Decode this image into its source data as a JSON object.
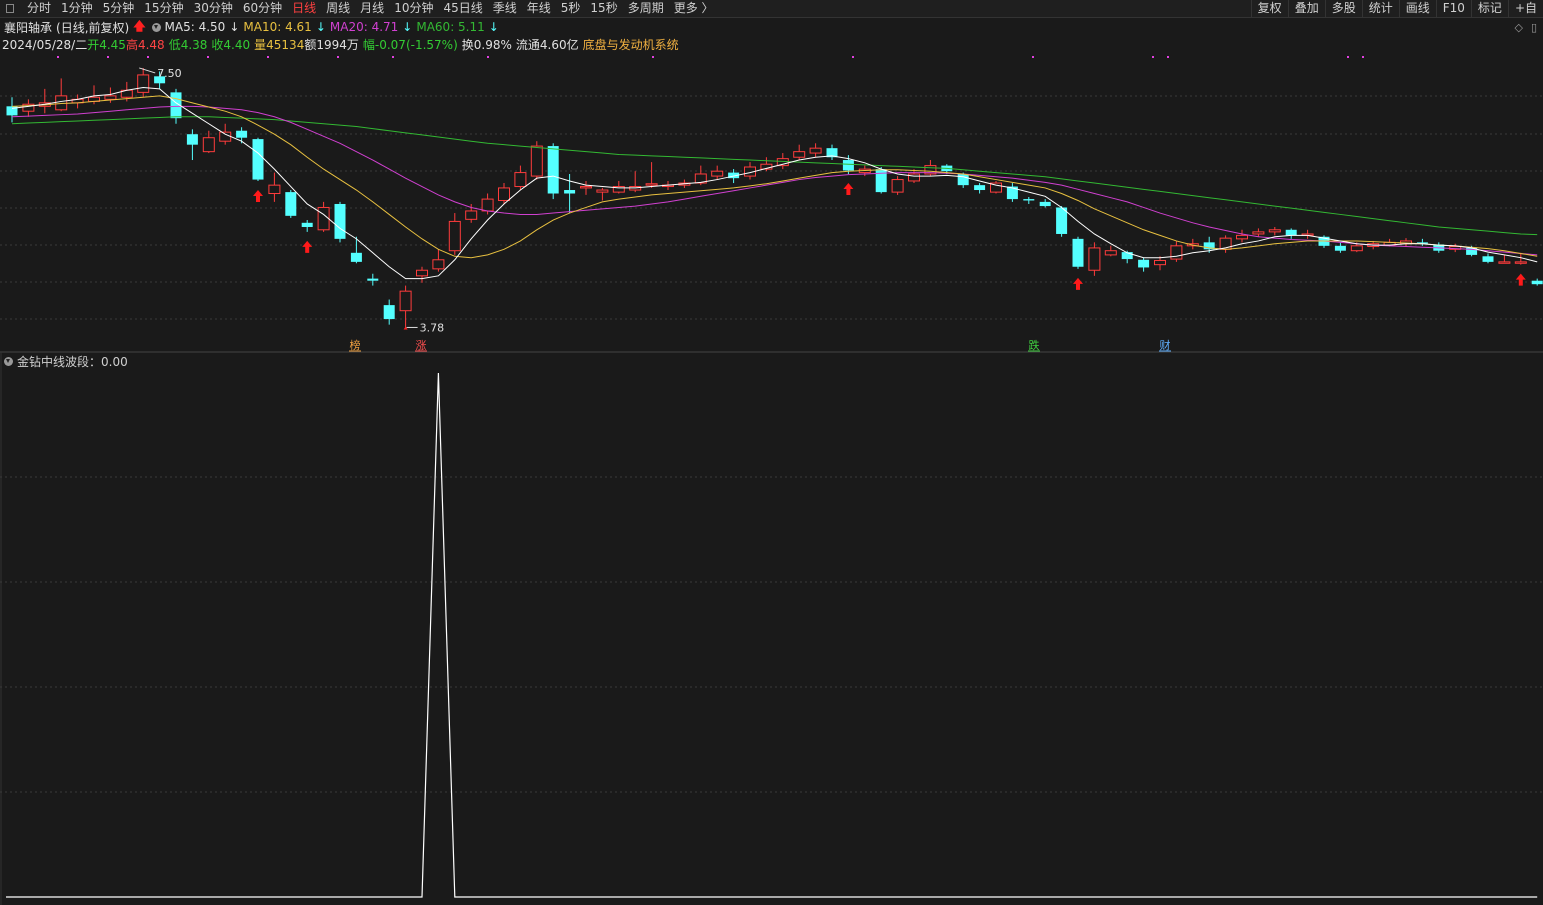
{
  "toolbar": {
    "periods": [
      "分时",
      "1分钟",
      "5分钟",
      "15分钟",
      "30分钟",
      "60分钟",
      "日线",
      "周线",
      "月线",
      "10分钟",
      "45日线",
      "季线",
      "年线",
      "5秒",
      "15秒",
      "多周期",
      "更多 〉"
    ],
    "active_period": "日线",
    "tools": [
      "复权",
      "叠加",
      "多股",
      "统计",
      "画线",
      "F10",
      "标记",
      "+自"
    ]
  },
  "stock": {
    "name": "襄阳轴承",
    "mode": "(日线,前复权)",
    "ma5": "MA5: 4.50",
    "ma10": "MA10: 4.61",
    "ma20": "MA20: 4.71",
    "ma60": "MA60: 5.11"
  },
  "quote": {
    "date": "2024/05/28/二",
    "open": "开4.45",
    "high": "高4.48",
    "low": "低4.38",
    "close": "收4.40",
    "volume": "量45134",
    "amount": "额1994万",
    "change": "幅-0.07(-1.57%)",
    "turnover": "换0.98%",
    "float": "流通4.60亿",
    "sector": "底盘与发动机系统"
  },
  "annotations": {
    "high_label": "7.50",
    "low_label": "3.78",
    "tags": [
      {
        "text": "榜",
        "color": "#f0a040"
      },
      {
        "text": "涨",
        "color": "#ff5050"
      },
      {
        "text": "跌",
        "color": "#40d040"
      },
      {
        "text": "财",
        "color": "#60b0ff"
      }
    ]
  },
  "sub_indicator": {
    "label": "金钻中线波段：0.00"
  },
  "colors": {
    "up": "#ff3c3c",
    "down": "#54ffff",
    "ma5": "#ffffff",
    "ma10": "#e8c040",
    "ma20": "#d040d0",
    "ma60": "#33b833",
    "grid": "#3a3a3a",
    "bg": "#1a1a1a"
  },
  "chart_data": {
    "type": "candlestick",
    "ylim": [
      3.6,
      7.7
    ],
    "candles": [
      [
        6.95,
        6.82,
        7.08,
        6.72
      ],
      [
        6.88,
        6.98,
        7.05,
        6.8
      ],
      [
        6.95,
        7.0,
        7.2,
        6.85
      ],
      [
        6.9,
        7.1,
        7.35,
        6.88
      ],
      [
        7.0,
        7.05,
        7.12,
        6.92
      ],
      [
        7.02,
        7.08,
        7.25,
        6.98
      ],
      [
        7.05,
        7.1,
        7.22,
        7.0
      ],
      [
        7.08,
        7.18,
        7.3,
        7.02
      ],
      [
        7.15,
        7.4,
        7.5,
        7.08
      ],
      [
        7.38,
        7.28,
        7.45,
        7.2
      ],
      [
        7.15,
        6.78,
        7.2,
        6.7
      ],
      [
        6.55,
        6.4,
        6.62,
        6.18
      ],
      [
        6.3,
        6.5,
        6.6,
        6.28
      ],
      [
        6.45,
        6.58,
        6.7,
        6.4
      ],
      [
        6.6,
        6.5,
        6.65,
        6.42
      ],
      [
        6.48,
        5.9,
        6.5,
        5.88
      ],
      [
        5.7,
        5.82,
        6.0,
        5.58
      ],
      [
        5.72,
        5.38,
        5.75,
        5.35
      ],
      [
        5.28,
        5.22,
        5.32,
        5.15
      ],
      [
        5.18,
        5.5,
        5.58,
        5.15
      ],
      [
        5.55,
        5.05,
        5.58,
        5.0
      ],
      [
        4.85,
        4.72,
        5.08,
        4.7
      ],
      [
        4.48,
        4.45,
        4.55,
        4.38
      ],
      [
        4.1,
        3.9,
        4.18,
        3.82
      ],
      [
        4.02,
        4.3,
        4.38,
        3.78
      ],
      [
        4.52,
        4.6,
        4.65,
        4.42
      ],
      [
        4.62,
        4.75,
        4.9,
        4.58
      ],
      [
        4.88,
        5.3,
        5.42,
        4.82
      ],
      [
        5.33,
        5.45,
        5.55,
        5.28
      ],
      [
        5.45,
        5.62,
        5.7,
        5.4
      ],
      [
        5.6,
        5.78,
        5.85,
        5.55
      ],
      [
        5.8,
        6.0,
        6.1,
        5.75
      ],
      [
        5.95,
        6.38,
        6.45,
        5.9
      ],
      [
        6.38,
        5.7,
        6.42,
        5.62
      ],
      [
        5.75,
        5.7,
        5.98,
        5.42
      ],
      [
        5.78,
        5.8,
        5.88,
        5.68
      ],
      [
        5.72,
        5.75,
        5.78,
        5.6
      ],
      [
        5.72,
        5.8,
        5.88,
        5.7
      ],
      [
        5.75,
        5.8,
        6.02,
        5.72
      ],
      [
        5.82,
        5.84,
        6.15,
        5.78
      ],
      [
        5.8,
        5.82,
        5.88,
        5.75
      ],
      [
        5.82,
        5.85,
        5.9,
        5.78
      ],
      [
        5.85,
        5.98,
        6.1,
        5.82
      ],
      [
        5.95,
        6.02,
        6.1,
        5.9
      ],
      [
        6.0,
        5.92,
        6.05,
        5.85
      ],
      [
        5.95,
        6.08,
        6.15,
        5.9
      ],
      [
        6.05,
        6.12,
        6.22,
        6.02
      ],
      [
        6.1,
        6.2,
        6.28,
        6.05
      ],
      [
        6.22,
        6.3,
        6.4,
        6.18
      ],
      [
        6.28,
        6.35,
        6.42,
        6.22
      ],
      [
        6.35,
        6.22,
        6.4,
        6.18
      ],
      [
        6.18,
        6.03,
        6.25,
        5.98
      ],
      [
        6.0,
        6.05,
        6.1,
        5.95
      ],
      [
        6.05,
        5.72,
        6.08,
        5.7
      ],
      [
        5.72,
        5.9,
        5.95,
        5.68
      ],
      [
        5.88,
        5.98,
        6.05,
        5.85
      ],
      [
        5.98,
        6.1,
        6.18,
        5.95
      ],
      [
        6.1,
        6.02,
        6.12,
        5.98
      ],
      [
        5.98,
        5.82,
        6.0,
        5.78
      ],
      [
        5.82,
        5.75,
        5.85,
        5.7
      ],
      [
        5.72,
        5.85,
        5.88,
        5.7
      ],
      [
        5.8,
        5.62,
        5.85,
        5.58
      ],
      [
        5.62,
        5.6,
        5.65,
        5.55
      ],
      [
        5.58,
        5.52,
        5.62,
        5.5
      ],
      [
        5.5,
        5.12,
        5.52,
        5.08
      ],
      [
        5.05,
        4.65,
        5.08,
        4.62
      ],
      [
        4.6,
        4.92,
        5.0,
        4.52
      ],
      [
        4.82,
        4.88,
        4.95,
        4.8
      ],
      [
        4.86,
        4.76,
        4.88,
        4.7
      ],
      [
        4.75,
        4.64,
        4.78,
        4.58
      ],
      [
        4.68,
        4.74,
        4.8,
        4.6
      ],
      [
        4.76,
        4.95,
        5.02,
        4.72
      ],
      [
        4.95,
        4.98,
        5.05,
        4.9
      ],
      [
        5.0,
        4.9,
        5.08,
        4.85
      ],
      [
        4.9,
        5.06,
        5.1,
        4.85
      ],
      [
        5.05,
        5.1,
        5.18,
        5.0
      ],
      [
        5.12,
        5.15,
        5.2,
        5.08
      ],
      [
        5.15,
        5.18,
        5.22,
        5.1
      ],
      [
        5.18,
        5.1,
        5.2,
        5.05
      ],
      [
        5.1,
        5.12,
        5.18,
        5.05
      ],
      [
        5.08,
        4.95,
        5.1,
        4.92
      ],
      [
        4.95,
        4.88,
        5.0,
        4.85
      ],
      [
        4.88,
        4.95,
        5.0,
        4.86
      ],
      [
        4.94,
        4.98,
        5.02,
        4.9
      ],
      [
        4.96,
        5.0,
        5.05,
        4.94
      ],
      [
        4.98,
        5.02,
        5.06,
        4.94
      ],
      [
        5.0,
        4.98,
        5.05,
        4.95
      ],
      [
        4.97,
        4.88,
        5.0,
        4.85
      ],
      [
        4.9,
        4.94,
        4.98,
        4.86
      ],
      [
        4.92,
        4.82,
        4.95,
        4.8
      ],
      [
        4.8,
        4.72,
        4.84,
        4.7
      ],
      [
        4.7,
        4.72,
        4.82,
        4.7
      ],
      [
        4.7,
        4.72,
        4.85,
        4.68
      ],
      [
        4.45,
        4.4,
        4.48,
        4.38
      ]
    ],
    "ma5": [
      6.92,
      6.95,
      6.98,
      7.02,
      7.05,
      7.1,
      7.12,
      7.18,
      7.22,
      7.2,
      7.0,
      6.85,
      6.7,
      6.55,
      6.45,
      6.28,
      6.05,
      5.8,
      5.55,
      5.4,
      5.2,
      5.05,
      4.85,
      4.65,
      4.48,
      4.48,
      4.52,
      4.75,
      5.05,
      5.32,
      5.55,
      5.75,
      5.92,
      5.95,
      5.88,
      5.82,
      5.8,
      5.78,
      5.78,
      5.8,
      5.82,
      5.84,
      5.86,
      5.9,
      5.95,
      6.0,
      6.06,
      6.12,
      6.18,
      6.22,
      6.24,
      6.2,
      6.14,
      6.05,
      5.98,
      5.95,
      5.95,
      5.96,
      5.94,
      5.88,
      5.82,
      5.78,
      5.72,
      5.66,
      5.5,
      5.3,
      5.12,
      4.98,
      4.85,
      4.78,
      4.78,
      4.8,
      4.85,
      4.88,
      4.92,
      4.98,
      5.02,
      5.08,
      5.1,
      5.1,
      5.06,
      5.02,
      4.98,
      4.96,
      4.96,
      4.98,
      4.98,
      4.96,
      4.95,
      4.92,
      4.86,
      4.82,
      4.78,
      4.72
    ],
    "ma10": [
      6.95,
      6.96,
      6.97,
      6.99,
      7.0,
      7.02,
      7.04,
      7.06,
      7.08,
      7.1,
      7.06,
      7.0,
      6.94,
      6.88,
      6.8,
      6.68,
      6.55,
      6.4,
      6.22,
      6.05,
      5.9,
      5.75,
      5.58,
      5.4,
      5.22,
      5.05,
      4.9,
      4.8,
      4.78,
      4.82,
      4.9,
      5.02,
      5.18,
      5.32,
      5.42,
      5.5,
      5.58,
      5.62,
      5.65,
      5.68,
      5.7,
      5.72,
      5.74,
      5.76,
      5.78,
      5.81,
      5.84,
      5.88,
      5.92,
      5.96,
      6.0,
      6.02,
      6.03,
      6.04,
      6.04,
      6.03,
      6.02,
      6.0,
      5.98,
      5.94,
      5.9,
      5.86,
      5.82,
      5.78,
      5.7,
      5.6,
      5.48,
      5.38,
      5.28,
      5.18,
      5.1,
      5.02,
      4.96,
      4.92,
      4.9,
      4.92,
      4.95,
      4.98,
      5.0,
      5.02,
      5.02,
      5.02,
      5.02,
      5.01,
      5.0,
      4.99,
      4.98,
      4.96,
      4.95,
      4.93,
      4.91,
      4.88,
      4.84,
      4.8
    ],
    "ma20": [
      6.8,
      6.81,
      6.82,
      6.83,
      6.84,
      6.86,
      6.88,
      6.9,
      6.92,
      6.94,
      6.95,
      6.95,
      6.94,
      6.92,
      6.9,
      6.86,
      6.8,
      6.72,
      6.62,
      6.52,
      6.42,
      6.3,
      6.18,
      6.05,
      5.92,
      5.8,
      5.68,
      5.58,
      5.5,
      5.45,
      5.42,
      5.4,
      5.4,
      5.42,
      5.44,
      5.46,
      5.48,
      5.5,
      5.52,
      5.55,
      5.58,
      5.62,
      5.66,
      5.7,
      5.74,
      5.78,
      5.82,
      5.86,
      5.9,
      5.93,
      5.95,
      5.97,
      5.98,
      5.99,
      6.0,
      6.0,
      6.0,
      5.99,
      5.98,
      5.96,
      5.94,
      5.92,
      5.89,
      5.86,
      5.82,
      5.76,
      5.7,
      5.64,
      5.58,
      5.5,
      5.42,
      5.35,
      5.28,
      5.22,
      5.17,
      5.12,
      5.08,
      5.06,
      5.04,
      5.03,
      5.02,
      5.0,
      4.98,
      4.96,
      4.95,
      4.94,
      4.93,
      4.92,
      4.91,
      4.9,
      4.88,
      4.86,
      4.84,
      4.82
    ],
    "ma60": [
      6.7,
      6.71,
      6.72,
      6.73,
      6.74,
      6.75,
      6.76,
      6.77,
      6.78,
      6.79,
      6.8,
      6.8,
      6.8,
      6.79,
      6.78,
      6.77,
      6.76,
      6.74,
      6.72,
      6.7,
      6.68,
      6.66,
      6.63,
      6.6,
      6.57,
      6.54,
      6.51,
      6.48,
      6.45,
      6.42,
      6.4,
      6.38,
      6.36,
      6.34,
      6.32,
      6.3,
      6.28,
      6.26,
      6.25,
      6.24,
      6.23,
      6.22,
      6.21,
      6.2,
      6.19,
      6.18,
      6.17,
      6.16,
      6.15,
      6.14,
      6.13,
      6.12,
      6.11,
      6.1,
      6.09,
      6.08,
      6.07,
      6.06,
      6.04,
      6.02,
      6.0,
      5.98,
      5.96,
      5.94,
      5.91,
      5.88,
      5.85,
      5.82,
      5.79,
      5.76,
      5.73,
      5.7,
      5.67,
      5.64,
      5.61,
      5.58,
      5.55,
      5.52,
      5.49,
      5.46,
      5.43,
      5.4,
      5.37,
      5.34,
      5.31,
      5.28,
      5.25,
      5.22,
      5.2,
      5.18,
      5.16,
      5.14,
      5.12,
      5.11
    ],
    "buy_signals": [
      15,
      18,
      51,
      65,
      92
    ],
    "sub_series": {
      "peak_index": 26,
      "peak_value": 1.0,
      "ylim": [
        0,
        1.0
      ]
    }
  }
}
